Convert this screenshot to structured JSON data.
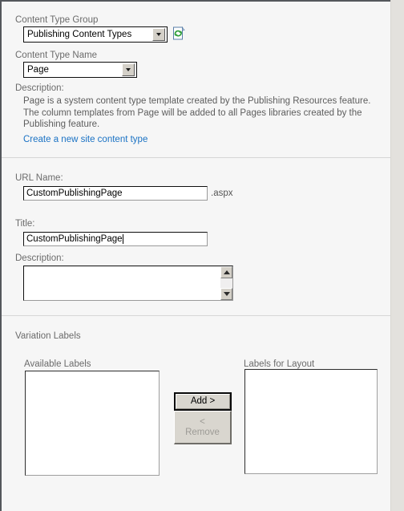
{
  "sections": {
    "content_type": {
      "group_label": "Content Type Group",
      "group_value": "Publishing Content Types",
      "name_label": "Content Type Name",
      "name_value": "Page",
      "description_label": "Description:",
      "description_text": "Page is a system content type template created by the Publishing Resources feature. The column templates from Page will be added to all Pages libraries created by the Publishing feature.",
      "create_link_text": "Create a new site content type",
      "refresh_icon": "refresh-page-icon",
      "link_color": "#1a72c4"
    },
    "page_info": {
      "url_name_label": "URL Name:",
      "url_name_value": "CustomPublishingPage",
      "url_name_placeholder": "",
      "url_suffix": ".aspx",
      "title_label": "Title:",
      "title_value": "CustomPublishingPage",
      "title_placeholder": "",
      "description_label": "Description:",
      "description_value": "",
      "description_placeholder": "",
      "scroll_up_icon": "scroll-up-arrow-icon",
      "scroll_down_icon": "scroll-down-arrow-icon"
    },
    "variations": {
      "heading": "Variation Labels",
      "available_caption": "Available Labels",
      "layout_caption": "Labels for Layout",
      "available_items": [],
      "layout_items": [],
      "add_button_label": "Add >",
      "remove_button_line1": "<",
      "remove_button_line2": "Remove",
      "remove_button_disabled": true
    }
  },
  "theme": {
    "page_background": "#f6f6f6",
    "gutter_background": "#e3e1dd",
    "label_color": "#6b6b6b",
    "text_color": "#000000",
    "divider_color": "#d6d6d6",
    "button_face": "#d9d6cf",
    "disabled_text": "#9d9b96"
  }
}
